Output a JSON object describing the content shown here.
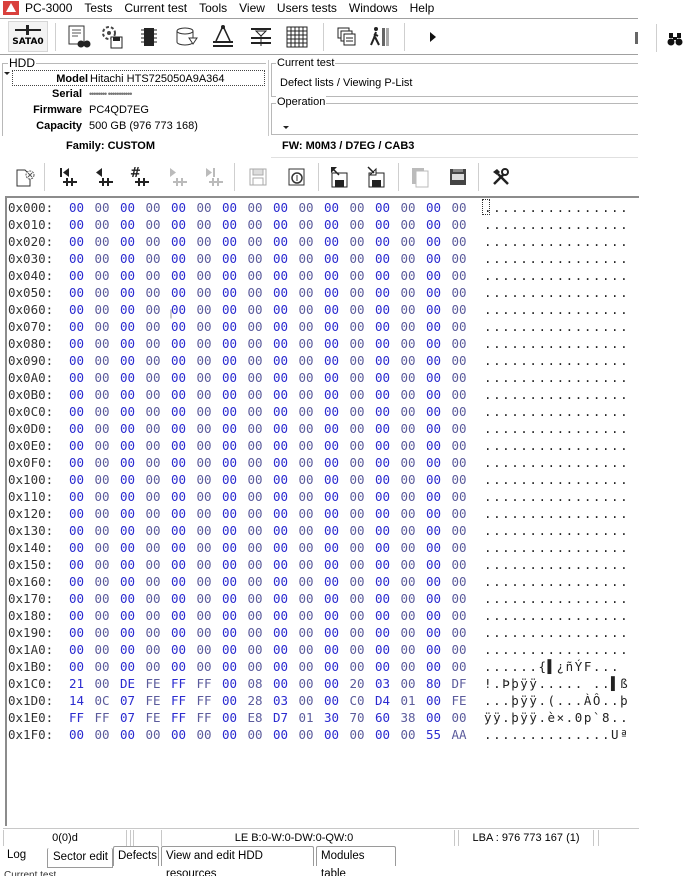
{
  "app": {
    "title": "PC-3000",
    "menu": [
      "PC-3000",
      "Tests",
      "Current test",
      "Tools",
      "View",
      "Users tests",
      "Windows",
      "Help"
    ]
  },
  "toolbar": {
    "port_label": "SATA0",
    "icons": [
      "sata-port-icon",
      "hdd-id-icon",
      "settings-disk-icon",
      "chip-icon",
      "disk-cylinder-icon",
      "compass-icon",
      "hdd-heads-icon",
      "grid-icon",
      "windows-icon",
      "run-script-icon",
      "play-icon",
      "binoculars-icon"
    ]
  },
  "hdd": {
    "group_title": "HDD",
    "fields": [
      {
        "label": "Model",
        "value": "Hitachi HTS725050A9A364"
      },
      {
        "label": "Serial",
        "value": "•••••••• •••••••••••"
      },
      {
        "label": "Firmware",
        "value": "PC4QD7EG"
      },
      {
        "label": "Capacity",
        "value": "500 GB (976 773 168)"
      }
    ],
    "family": "Family: CUSTOM",
    "fw": "FW: M0M3 / D7EG / CAB3"
  },
  "current_test": {
    "title": "Current test",
    "value": "Defect lists / Viewing P-List"
  },
  "operation": {
    "title": "Operation",
    "value": ""
  },
  "sector_toolbar": {
    "icons": [
      "close-sector-icon",
      "first-sector-icon",
      "prev-sector-icon",
      "goto-sector-icon",
      "next-sector-icon",
      "last-sector-icon",
      "save-disabled-icon",
      "refresh-disk-icon",
      "export-to-file-icon",
      "import-from-file-icon",
      "copy-icon",
      "hex-mode-icon",
      "tools-icon"
    ]
  },
  "hex": {
    "rows": [
      {
        "addr": "0x000:",
        "bytes": [
          "00",
          "00",
          "00",
          "00",
          "00",
          "00",
          "00",
          "00",
          "00",
          "00",
          "00",
          "00",
          "00",
          "00",
          "00",
          "00"
        ],
        "ascii": "................"
      },
      {
        "addr": "0x010:",
        "bytes": [
          "00",
          "00",
          "00",
          "00",
          "00",
          "00",
          "00",
          "00",
          "00",
          "00",
          "00",
          "00",
          "00",
          "00",
          "00",
          "00"
        ],
        "ascii": "................"
      },
      {
        "addr": "0x020:",
        "bytes": [
          "00",
          "00",
          "00",
          "00",
          "00",
          "00",
          "00",
          "00",
          "00",
          "00",
          "00",
          "00",
          "00",
          "00",
          "00",
          "00"
        ],
        "ascii": "................"
      },
      {
        "addr": "0x030:",
        "bytes": [
          "00",
          "00",
          "00",
          "00",
          "00",
          "00",
          "00",
          "00",
          "00",
          "00",
          "00",
          "00",
          "00",
          "00",
          "00",
          "00"
        ],
        "ascii": "................"
      },
      {
        "addr": "0x040:",
        "bytes": [
          "00",
          "00",
          "00",
          "00",
          "00",
          "00",
          "00",
          "00",
          "00",
          "00",
          "00",
          "00",
          "00",
          "00",
          "00",
          "00"
        ],
        "ascii": "................"
      },
      {
        "addr": "0x050:",
        "bytes": [
          "00",
          "00",
          "00",
          "00",
          "00",
          "00",
          "00",
          "00",
          "00",
          "00",
          "00",
          "00",
          "00",
          "00",
          "00",
          "00"
        ],
        "ascii": "................"
      },
      {
        "addr": "0x060:",
        "bytes": [
          "00",
          "00",
          "00",
          "00",
          "00",
          "00",
          "00",
          "00",
          "00",
          "00",
          "00",
          "00",
          "00",
          "00",
          "00",
          "00"
        ],
        "ascii": "................"
      },
      {
        "addr": "0x070:",
        "bytes": [
          "00",
          "00",
          "00",
          "00",
          "00",
          "00",
          "00",
          "00",
          "00",
          "00",
          "00",
          "00",
          "00",
          "00",
          "00",
          "00"
        ],
        "ascii": "................"
      },
      {
        "addr": "0x080:",
        "bytes": [
          "00",
          "00",
          "00",
          "00",
          "00",
          "00",
          "00",
          "00",
          "00",
          "00",
          "00",
          "00",
          "00",
          "00",
          "00",
          "00"
        ],
        "ascii": "................"
      },
      {
        "addr": "0x090:",
        "bytes": [
          "00",
          "00",
          "00",
          "00",
          "00",
          "00",
          "00",
          "00",
          "00",
          "00",
          "00",
          "00",
          "00",
          "00",
          "00",
          "00"
        ],
        "ascii": "................"
      },
      {
        "addr": "0x0A0:",
        "bytes": [
          "00",
          "00",
          "00",
          "00",
          "00",
          "00",
          "00",
          "00",
          "00",
          "00",
          "00",
          "00",
          "00",
          "00",
          "00",
          "00"
        ],
        "ascii": "................"
      },
      {
        "addr": "0x0B0:",
        "bytes": [
          "00",
          "00",
          "00",
          "00",
          "00",
          "00",
          "00",
          "00",
          "00",
          "00",
          "00",
          "00",
          "00",
          "00",
          "00",
          "00"
        ],
        "ascii": "................"
      },
      {
        "addr": "0x0C0:",
        "bytes": [
          "00",
          "00",
          "00",
          "00",
          "00",
          "00",
          "00",
          "00",
          "00",
          "00",
          "00",
          "00",
          "00",
          "00",
          "00",
          "00"
        ],
        "ascii": "................"
      },
      {
        "addr": "0x0D0:",
        "bytes": [
          "00",
          "00",
          "00",
          "00",
          "00",
          "00",
          "00",
          "00",
          "00",
          "00",
          "00",
          "00",
          "00",
          "00",
          "00",
          "00"
        ],
        "ascii": "................"
      },
      {
        "addr": "0x0E0:",
        "bytes": [
          "00",
          "00",
          "00",
          "00",
          "00",
          "00",
          "00",
          "00",
          "00",
          "00",
          "00",
          "00",
          "00",
          "00",
          "00",
          "00"
        ],
        "ascii": "................"
      },
      {
        "addr": "0x0F0:",
        "bytes": [
          "00",
          "00",
          "00",
          "00",
          "00",
          "00",
          "00",
          "00",
          "00",
          "00",
          "00",
          "00",
          "00",
          "00",
          "00",
          "00"
        ],
        "ascii": "................"
      },
      {
        "addr": "0x100:",
        "bytes": [
          "00",
          "00",
          "00",
          "00",
          "00",
          "00",
          "00",
          "00",
          "00",
          "00",
          "00",
          "00",
          "00",
          "00",
          "00",
          "00"
        ],
        "ascii": "................"
      },
      {
        "addr": "0x110:",
        "bytes": [
          "00",
          "00",
          "00",
          "00",
          "00",
          "00",
          "00",
          "00",
          "00",
          "00",
          "00",
          "00",
          "00",
          "00",
          "00",
          "00"
        ],
        "ascii": "................"
      },
      {
        "addr": "0x120:",
        "bytes": [
          "00",
          "00",
          "00",
          "00",
          "00",
          "00",
          "00",
          "00",
          "00",
          "00",
          "00",
          "00",
          "00",
          "00",
          "00",
          "00"
        ],
        "ascii": "................"
      },
      {
        "addr": "0x130:",
        "bytes": [
          "00",
          "00",
          "00",
          "00",
          "00",
          "00",
          "00",
          "00",
          "00",
          "00",
          "00",
          "00",
          "00",
          "00",
          "00",
          "00"
        ],
        "ascii": "................"
      },
      {
        "addr": "0x140:",
        "bytes": [
          "00",
          "00",
          "00",
          "00",
          "00",
          "00",
          "00",
          "00",
          "00",
          "00",
          "00",
          "00",
          "00",
          "00",
          "00",
          "00"
        ],
        "ascii": "................"
      },
      {
        "addr": "0x150:",
        "bytes": [
          "00",
          "00",
          "00",
          "00",
          "00",
          "00",
          "00",
          "00",
          "00",
          "00",
          "00",
          "00",
          "00",
          "00",
          "00",
          "00"
        ],
        "ascii": "................"
      },
      {
        "addr": "0x160:",
        "bytes": [
          "00",
          "00",
          "00",
          "00",
          "00",
          "00",
          "00",
          "00",
          "00",
          "00",
          "00",
          "00",
          "00",
          "00",
          "00",
          "00"
        ],
        "ascii": "................"
      },
      {
        "addr": "0x170:",
        "bytes": [
          "00",
          "00",
          "00",
          "00",
          "00",
          "00",
          "00",
          "00",
          "00",
          "00",
          "00",
          "00",
          "00",
          "00",
          "00",
          "00"
        ],
        "ascii": "................"
      },
      {
        "addr": "0x180:",
        "bytes": [
          "00",
          "00",
          "00",
          "00",
          "00",
          "00",
          "00",
          "00",
          "00",
          "00",
          "00",
          "00",
          "00",
          "00",
          "00",
          "00"
        ],
        "ascii": "................"
      },
      {
        "addr": "0x190:",
        "bytes": [
          "00",
          "00",
          "00",
          "00",
          "00",
          "00",
          "00",
          "00",
          "00",
          "00",
          "00",
          "00",
          "00",
          "00",
          "00",
          "00"
        ],
        "ascii": "................"
      },
      {
        "addr": "0x1A0:",
        "bytes": [
          "00",
          "00",
          "00",
          "00",
          "00",
          "00",
          "00",
          "00",
          "00",
          "00",
          "00",
          "00",
          "00",
          "00",
          "00",
          "00"
        ],
        "ascii": "................"
      },
      {
        "addr": "0x1B0:",
        "bytes": [
          "00",
          "00",
          "00",
          "00",
          "00",
          "00",
          "00",
          "00",
          "00",
          "00",
          "00",
          "00",
          "00",
          "00",
          "00",
          "00"
        ],
        "ascii": "......{▌¿ñÝF..."
      },
      {
        "addr": "0x1C0:",
        "bytes": [
          "21",
          "00",
          "DE",
          "FE",
          "FF",
          "FF",
          "00",
          "08",
          "00",
          "00",
          "00",
          "20",
          "03",
          "00",
          "80",
          "DF"
        ],
        "ascii": "!.Þþÿÿ..... ..▌ß"
      },
      {
        "addr": "0x1D0:",
        "bytes": [
          "14",
          "0C",
          "07",
          "FE",
          "FF",
          "FF",
          "00",
          "28",
          "03",
          "00",
          "00",
          "C0",
          "D4",
          "01",
          "00",
          "FE"
        ],
        "ascii": "...þÿÿ.(...ÀÔ..þ"
      },
      {
        "addr": "0x1E0:",
        "bytes": [
          "FF",
          "FF",
          "07",
          "FE",
          "FF",
          "FF",
          "00",
          "E8",
          "D7",
          "01",
          "30",
          "70",
          "60",
          "38",
          "00",
          "00"
        ],
        "ascii": "ÿÿ.þÿÿ.è×.0p`8.."
      },
      {
        "addr": "0x1F0:",
        "bytes": [
          "00",
          "00",
          "00",
          "00",
          "00",
          "00",
          "00",
          "00",
          "00",
          "00",
          "00",
          "00",
          "00",
          "00",
          "55",
          "AA"
        ],
        "ascii": "..............Uª"
      }
    ]
  },
  "status_bar": {
    "position": "0(0)d",
    "empty": "",
    "errors": "LE B:0-W:0-DW:0-QW:0",
    "lba": "LBA : 976 773 167 (1)"
  },
  "tabs": [
    {
      "label": "Log",
      "active": false
    },
    {
      "label": "Sector edit",
      "active": true
    },
    {
      "label": "Defects",
      "active": false
    },
    {
      "label": "View and edit HDD resources",
      "active": false
    },
    {
      "label": "Modules table",
      "active": false
    }
  ],
  "footer_text": "Current test"
}
